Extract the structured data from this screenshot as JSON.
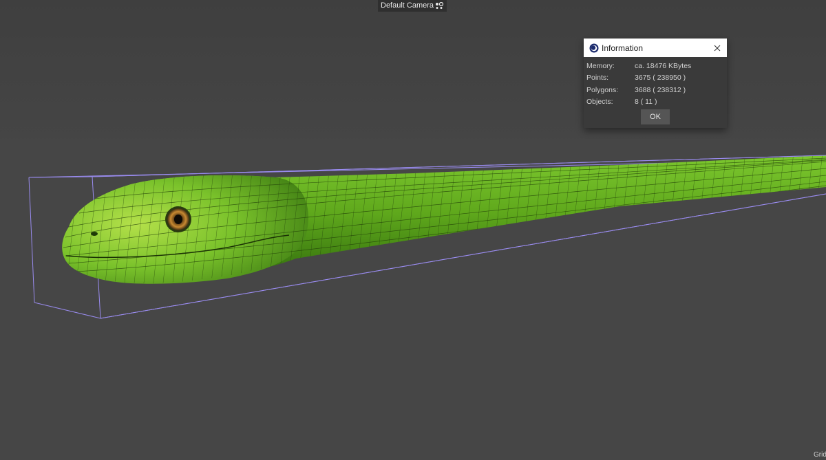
{
  "viewport": {
    "camera_label": "Default Camera",
    "camera_icon": "camera-icon",
    "grid_label": "Grid"
  },
  "info_dialog": {
    "title": "Information",
    "app_icon": "cinema4d-icon",
    "close_icon": "close-icon",
    "rows": [
      {
        "label": "Memory:",
        "value": "ca. 18476 KBytes"
      },
      {
        "label": "Points:",
        "value": "3675 ( 238950 )"
      },
      {
        "label": "Polygons:",
        "value": "3688 ( 238312 )"
      },
      {
        "label": "Objects:",
        "value": "8 ( 11 )"
      }
    ],
    "ok_label": "OK"
  },
  "colors": {
    "background": "#444444",
    "bounding_box": "#9a8cf0",
    "snake_green": "#5fa81c",
    "snake_light": "#a3d93d",
    "eye_iris": "#b07a2a"
  }
}
